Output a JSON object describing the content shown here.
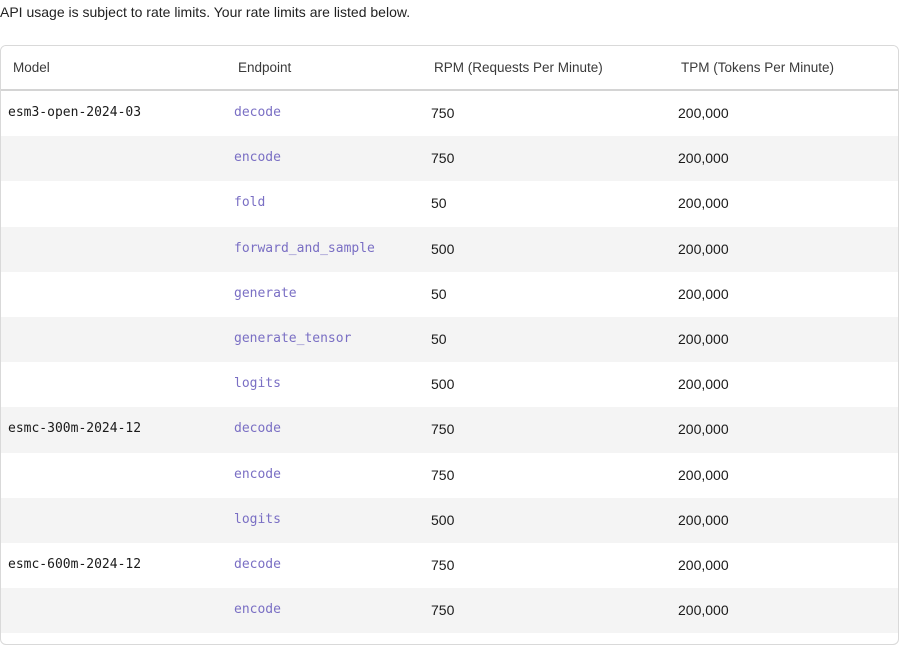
{
  "intro": "API usage is subject to rate limits. Your rate limits are listed below.",
  "table": {
    "headers": {
      "model": "Model",
      "endpoint": "Endpoint",
      "rpm": "RPM (Requests Per Minute)",
      "tpm": "TPM (Tokens Per Minute)"
    },
    "rows": [
      {
        "model": "esm3-open-2024-03",
        "endpoint": "decode",
        "rpm": "750",
        "tpm": "200,000"
      },
      {
        "model": "",
        "endpoint": "encode",
        "rpm": "750",
        "tpm": "200,000"
      },
      {
        "model": "",
        "endpoint": "fold",
        "rpm": "50",
        "tpm": "200,000"
      },
      {
        "model": "",
        "endpoint": "forward_and_sample",
        "rpm": "500",
        "tpm": "200,000"
      },
      {
        "model": "",
        "endpoint": "generate",
        "rpm": "50",
        "tpm": "200,000"
      },
      {
        "model": "",
        "endpoint": "generate_tensor",
        "rpm": "50",
        "tpm": "200,000"
      },
      {
        "model": "",
        "endpoint": "logits",
        "rpm": "500",
        "tpm": "200,000"
      },
      {
        "model": "esmc-300m-2024-12",
        "endpoint": "decode",
        "rpm": "750",
        "tpm": "200,000"
      },
      {
        "model": "",
        "endpoint": "encode",
        "rpm": "750",
        "tpm": "200,000"
      },
      {
        "model": "",
        "endpoint": "logits",
        "rpm": "500",
        "tpm": "200,000"
      },
      {
        "model": "esmc-600m-2024-12",
        "endpoint": "decode",
        "rpm": "750",
        "tpm": "200,000"
      },
      {
        "model": "",
        "endpoint": "encode",
        "rpm": "750",
        "tpm": "200,000"
      }
    ]
  },
  "colors": {
    "endpoint_text": "#7a6fc4",
    "row_alt_bg": "#f4f4f4",
    "border": "#d9d9d9"
  }
}
